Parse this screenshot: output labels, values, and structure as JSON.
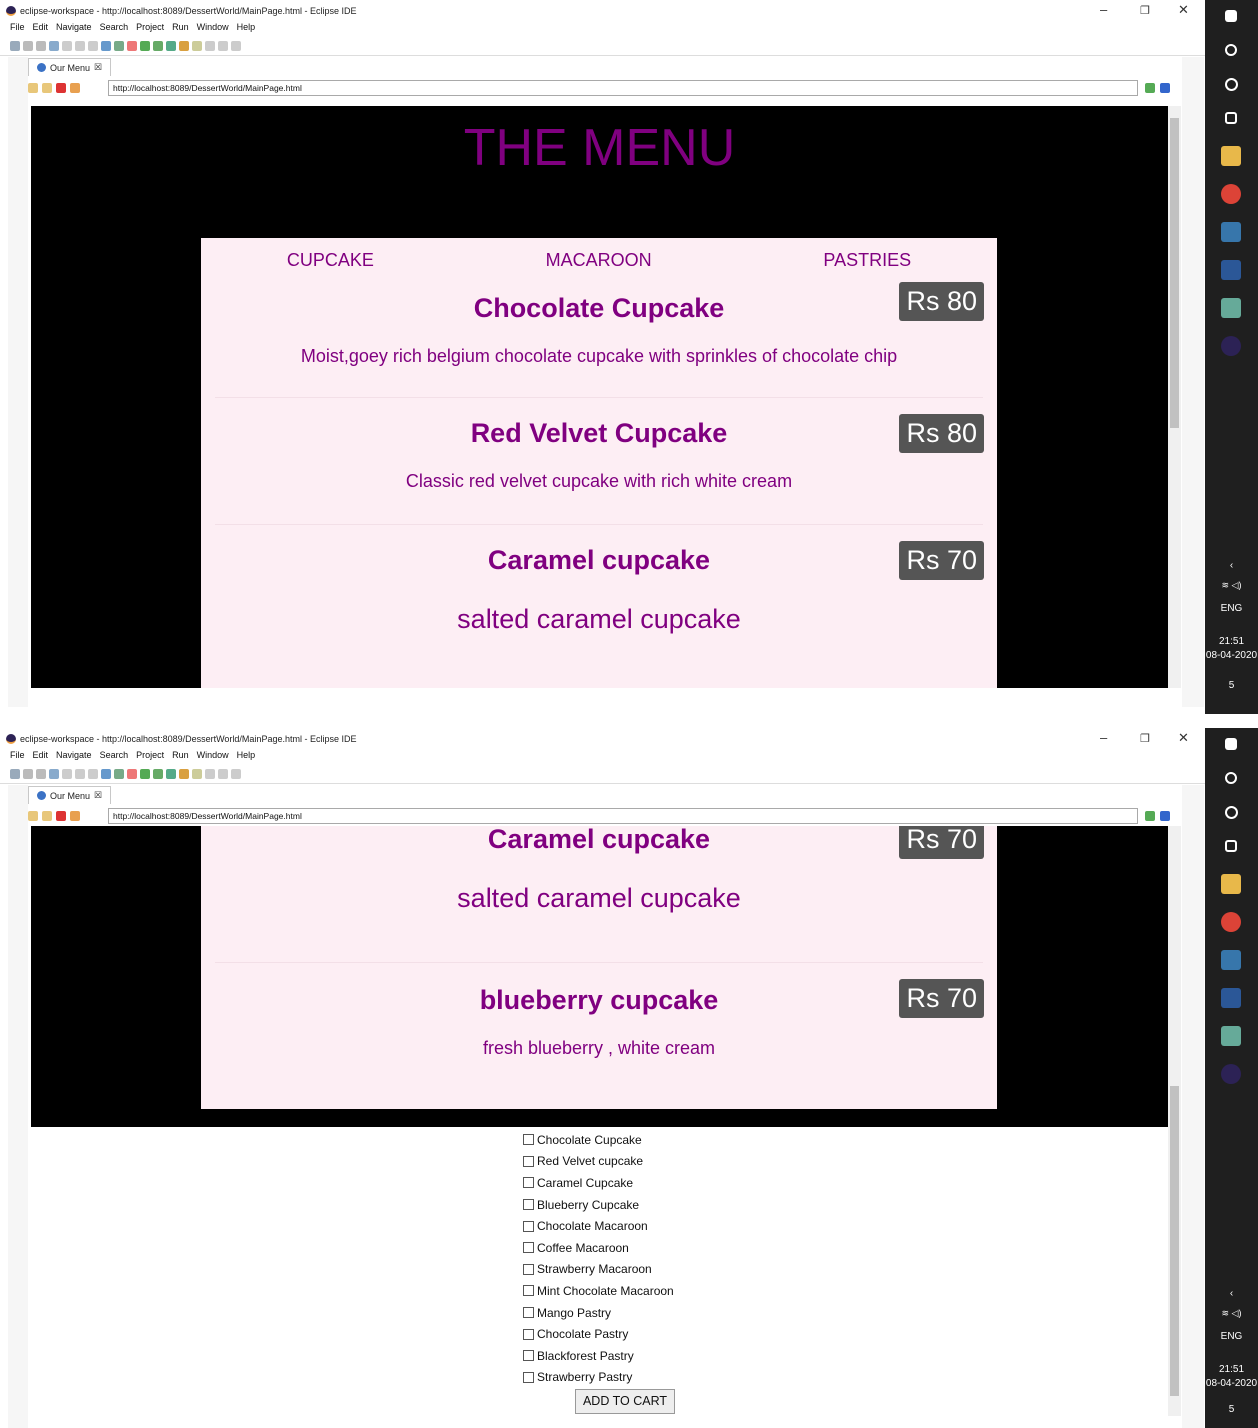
{
  "window": {
    "title": "eclipse-workspace - http://localhost:8089/DessertWorld/MainPage.html - Eclipse IDE",
    "min": "–",
    "max": "❐",
    "close": "✕"
  },
  "menu": [
    "File",
    "Edit",
    "Navigate",
    "Search",
    "Project",
    "Run",
    "Window",
    "Help"
  ],
  "tab": {
    "label": "Our Menu",
    "close": "☒"
  },
  "url": "http://localhost:8089/DessertWorld/MainPage.html",
  "page": {
    "heading": "THE MENU",
    "categories": [
      "CUPCAKE",
      "MACAROON",
      "PASTRIES"
    ],
    "items": [
      {
        "name": "Chocolate Cupcake",
        "price": "Rs 80",
        "desc": "Moist,goey rich belgium chocolate cupcake with sprinkles of chocolate chip"
      },
      {
        "name": "Red Velvet Cupcake",
        "price": "Rs 80",
        "desc": "Classic red velvet cupcake with rich white cream"
      },
      {
        "name": "Caramel cupcake",
        "price": "Rs 70",
        "desc": "salted caramel cupcake"
      },
      {
        "name": "blueberry cupcake",
        "price": "Rs 70",
        "desc": "fresh blueberry , white cream"
      }
    ],
    "checkboxes": [
      "Chocolate Cupcake",
      "Red Velvet cupcake",
      "Caramel Cupcake",
      "Blueberry Cupcake",
      "Chocolate Macaroon",
      "Coffee Macaroon",
      "Strawberry Macaroon",
      "Mint Chocolate Macaroon",
      "Mango Pastry",
      "Chocolate Pastry",
      "Blackforest Pastry",
      "Strawberry Pastry"
    ],
    "cart_button": "ADD TO CART"
  },
  "taskbar": {
    "lang": "ENG",
    "time": "21:51",
    "date": "08-04-2020",
    "notif": "5"
  },
  "icons": [
    "windows-icon",
    "search-icon",
    "cortana-icon",
    "task-view-icon",
    "file-explorer-icon",
    "chrome-icon",
    "python-icon",
    "word-icon",
    "notepad-icon",
    "eclipse-icon"
  ]
}
